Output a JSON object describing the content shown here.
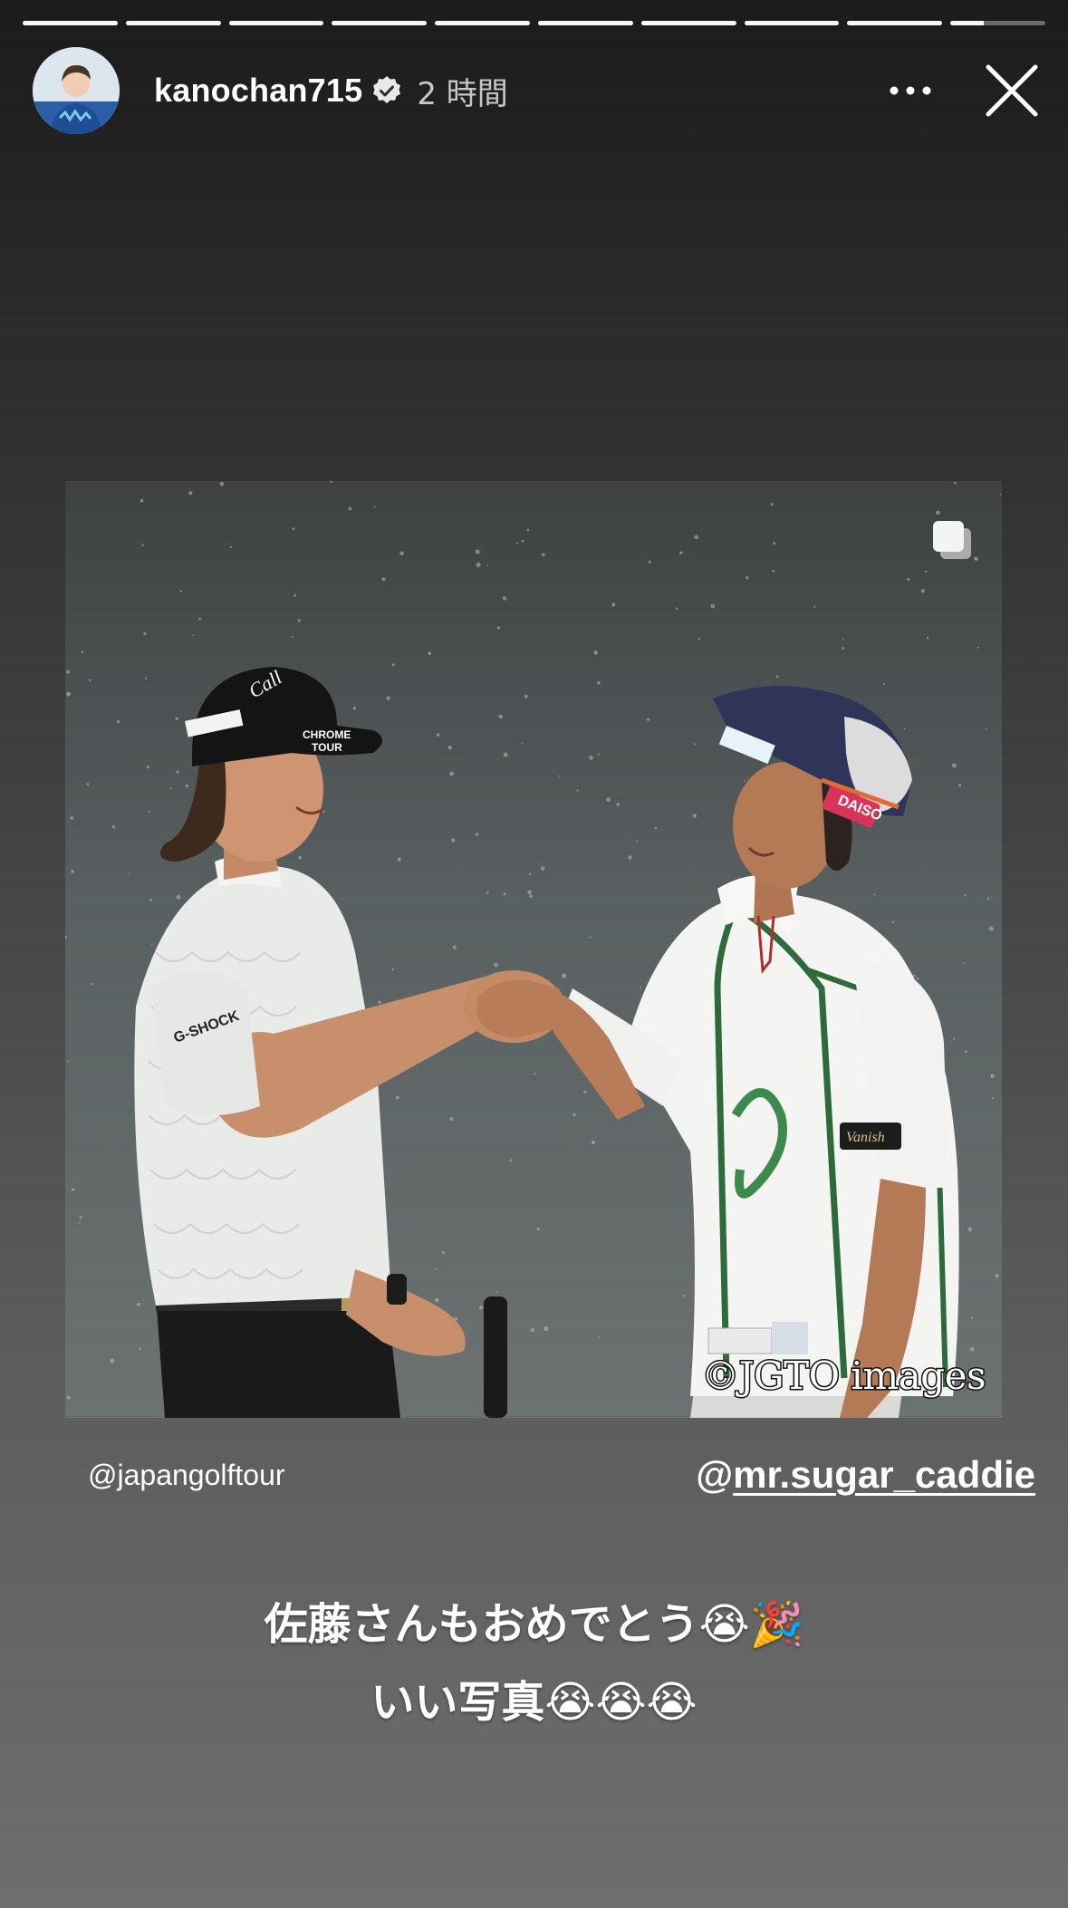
{
  "story": {
    "segments_total": 10,
    "segments_viewed": 9,
    "current_segment_progress": 0.35
  },
  "header": {
    "username": "kanochan715",
    "verified": true,
    "time_ago": "2 時間"
  },
  "photo": {
    "credit": "©JGTO images",
    "carousel_indicator": "multiple-images-icon"
  },
  "mentions": {
    "left": "@japangolftour",
    "right_at": "@",
    "right_handle": "mr.sugar_caddie"
  },
  "caption": {
    "line1": "佐藤さんもおめでとう😭🎉",
    "line2": "いい写真😭😭😭"
  },
  "icons": {
    "more": "more-horizontal-icon",
    "close": "close-icon",
    "verified": "verified-badge-icon"
  }
}
